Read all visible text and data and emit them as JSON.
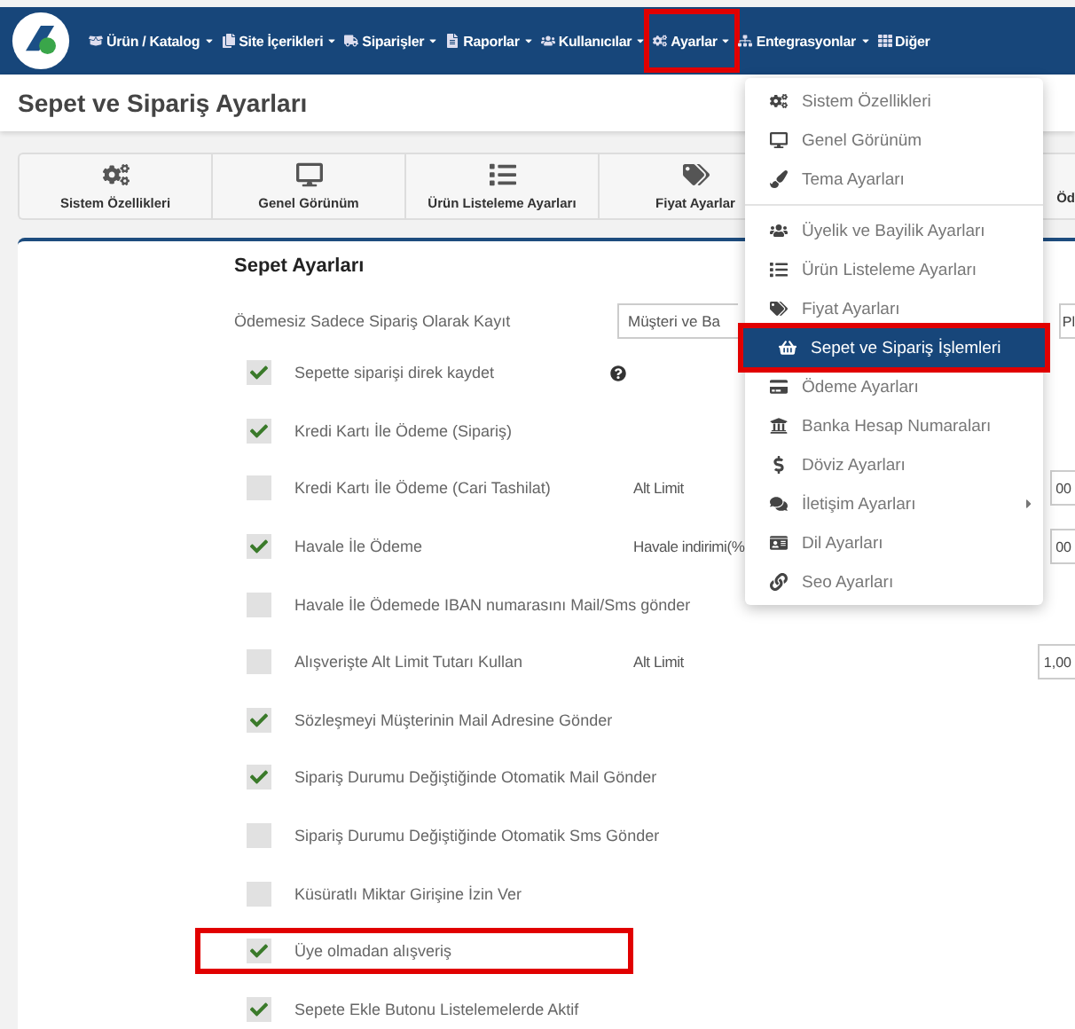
{
  "navbar": {
    "items": [
      {
        "label": "Ürün / Katalog",
        "highlighted": false
      },
      {
        "label": "Site İçerikleri",
        "highlighted": false
      },
      {
        "label": "Siparişler",
        "highlighted": false
      },
      {
        "label": "Raporlar",
        "highlighted": false
      },
      {
        "label": "Kullanıcılar",
        "highlighted": false
      },
      {
        "label": "Ayarlar",
        "highlighted": true
      },
      {
        "label": "Entegrasyonlar",
        "highlighted": false
      },
      {
        "label": "Diğer",
        "highlighted": false
      }
    ]
  },
  "page_title": "Sepet ve Sipariş Ayarları",
  "tabs": [
    {
      "label": "Sistem Özellikleri"
    },
    {
      "label": "Genel Görünüm"
    },
    {
      "label": "Ürün Listeleme Ayarları"
    },
    {
      "label": "Fiyat Ayarlar"
    },
    {
      "label": "Öd"
    }
  ],
  "section_title": "Sepet Ayarları",
  "rows": [
    {
      "kind": "select",
      "label": "Ödemesiz Sadece Sipariş Olarak Kayıt",
      "value": "Müşteri ve Ba",
      "trailing": "Pl"
    },
    {
      "kind": "checkbox",
      "label": "Sepette siparişi direk kaydet",
      "checked": true,
      "help": true,
      "highlighted": false
    },
    {
      "kind": "checkbox",
      "label": "Kredi Kartı İle Ödeme (Sipariş)",
      "checked": true,
      "highlighted": false
    },
    {
      "kind": "checkbox",
      "label": "Kredi Kartı İle Ödeme (Cari Tashilat)",
      "checked": false,
      "highlighted": false,
      "extra_label": "Alt Limit",
      "field": "00"
    },
    {
      "kind": "checkbox",
      "label": "Havale İle Ödeme",
      "checked": true,
      "highlighted": false,
      "extra_label": "Havale indirimi(%",
      "field": "00"
    },
    {
      "kind": "checkbox",
      "label": "Havale İle Ödemede IBAN numarasını Mail/Sms gönder",
      "checked": false,
      "highlighted": false
    },
    {
      "kind": "checkbox",
      "label": "Alışverişte Alt Limit Tutarı Kullan",
      "checked": false,
      "highlighted": false,
      "extra_label": "Alt Limit",
      "field": "1,00"
    },
    {
      "kind": "checkbox",
      "label": "Sözleşmeyi Müşterinin Mail Adresine Gönder",
      "checked": true,
      "highlighted": false
    },
    {
      "kind": "checkbox",
      "label": "Sipariş Durumu Değiştiğinde Otomatik Mail Gönder",
      "checked": true,
      "highlighted": false
    },
    {
      "kind": "checkbox",
      "label": "Sipariş Durumu Değiştiğinde Otomatik Sms Gönder",
      "checked": false,
      "highlighted": false
    },
    {
      "kind": "checkbox",
      "label": "Küsüratlı Miktar Girişine İzin Ver",
      "checked": false,
      "highlighted": false
    },
    {
      "kind": "checkbox",
      "label": "Üye olmadan alışveriş",
      "checked": true,
      "highlighted": true
    },
    {
      "kind": "checkbox",
      "label": "Sepete Ekle Butonu Listelemelerde Aktif",
      "checked": true,
      "highlighted": false
    }
  ],
  "menu": {
    "groups": [
      [
        {
          "label": "Sistem Özellikleri",
          "selected": false,
          "has_submenu": false
        },
        {
          "label": "Genel Görünüm",
          "selected": false,
          "has_submenu": false
        },
        {
          "label": "Tema Ayarları",
          "selected": false,
          "has_submenu": false
        }
      ],
      [
        {
          "label": "Üyelik ve Bayilik Ayarları",
          "selected": false,
          "has_submenu": false
        },
        {
          "label": "Ürün Listeleme Ayarları",
          "selected": false,
          "has_submenu": false
        },
        {
          "label": "Fiyat Ayarları",
          "selected": false,
          "has_submenu": false
        },
        {
          "label": "Sepet ve Sipariş İşlemleri",
          "selected": true,
          "has_submenu": false
        },
        {
          "label": "Ödeme Ayarları",
          "selected": false,
          "has_submenu": false
        },
        {
          "label": "Banka Hesap Numaraları",
          "selected": false,
          "has_submenu": false
        },
        {
          "label": "Döviz Ayarları",
          "selected": false,
          "has_submenu": false
        },
        {
          "label": "İletişim Ayarları",
          "selected": false,
          "has_submenu": true
        },
        {
          "label": "Dil Ayarları",
          "selected": false,
          "has_submenu": false
        },
        {
          "label": "Seo Ayarları",
          "selected": false,
          "has_submenu": false
        }
      ]
    ]
  }
}
